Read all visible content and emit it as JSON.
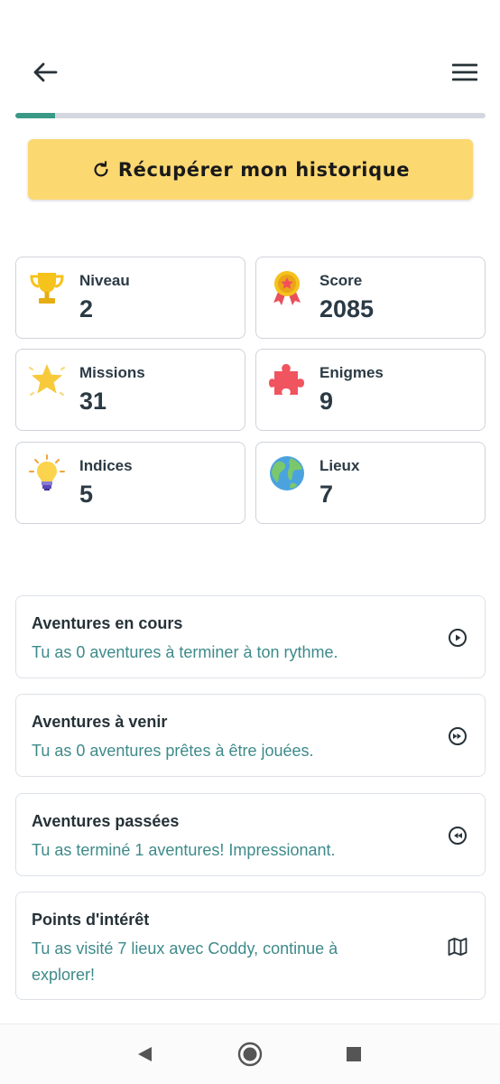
{
  "header": {
    "back_icon": "arrow-left-icon",
    "menu_icon": "hamburger-menu-icon"
  },
  "progress": {
    "fraction": 0.085,
    "fill_color": "#3a9a86",
    "track_color": "#d5d7e0"
  },
  "history_button": {
    "icon": "refresh-icon",
    "label": "Récupérer mon historique",
    "color": "#fcd871"
  },
  "stats": [
    {
      "icon": "trophy-icon",
      "label": "Niveau",
      "value": "2"
    },
    {
      "icon": "medal-icon",
      "label": "Score",
      "value": "2085"
    },
    {
      "icon": "star-icon",
      "label": "Missions",
      "value": "31"
    },
    {
      "icon": "puzzle-piece-icon",
      "label": "Enigmes",
      "value": "9"
    },
    {
      "icon": "lightbulb-icon",
      "label": "Indices",
      "value": "5"
    },
    {
      "icon": "globe-icon",
      "label": "Lieux",
      "value": "7"
    }
  ],
  "adventures": [
    {
      "title": "Aventures en cours",
      "subtitle": "Tu as 0 aventures à terminer à ton rythme.",
      "icon": "play-circle-icon"
    },
    {
      "title": "Aventures à venir",
      "subtitle": "Tu as 0 aventures prêtes à être jouées.",
      "icon": "fast-forward-circle-icon"
    },
    {
      "title": "Aventures passées",
      "subtitle": "Tu as terminé 1 aventures! Impressionant.",
      "icon": "rewind-circle-icon"
    },
    {
      "title": "Points d'intérêt",
      "subtitle": "Tu as visité 7 lieux avec Coddy, continue à explorer!",
      "icon": "map-icon"
    }
  ],
  "system_nav": {
    "back_icon": "nav-back-triangle-icon",
    "home_icon": "nav-home-circle-icon",
    "recents_icon": "nav-recents-square-icon"
  },
  "colors": {
    "accent_teal": "#3e8a8a",
    "text_dark": "#263238"
  }
}
